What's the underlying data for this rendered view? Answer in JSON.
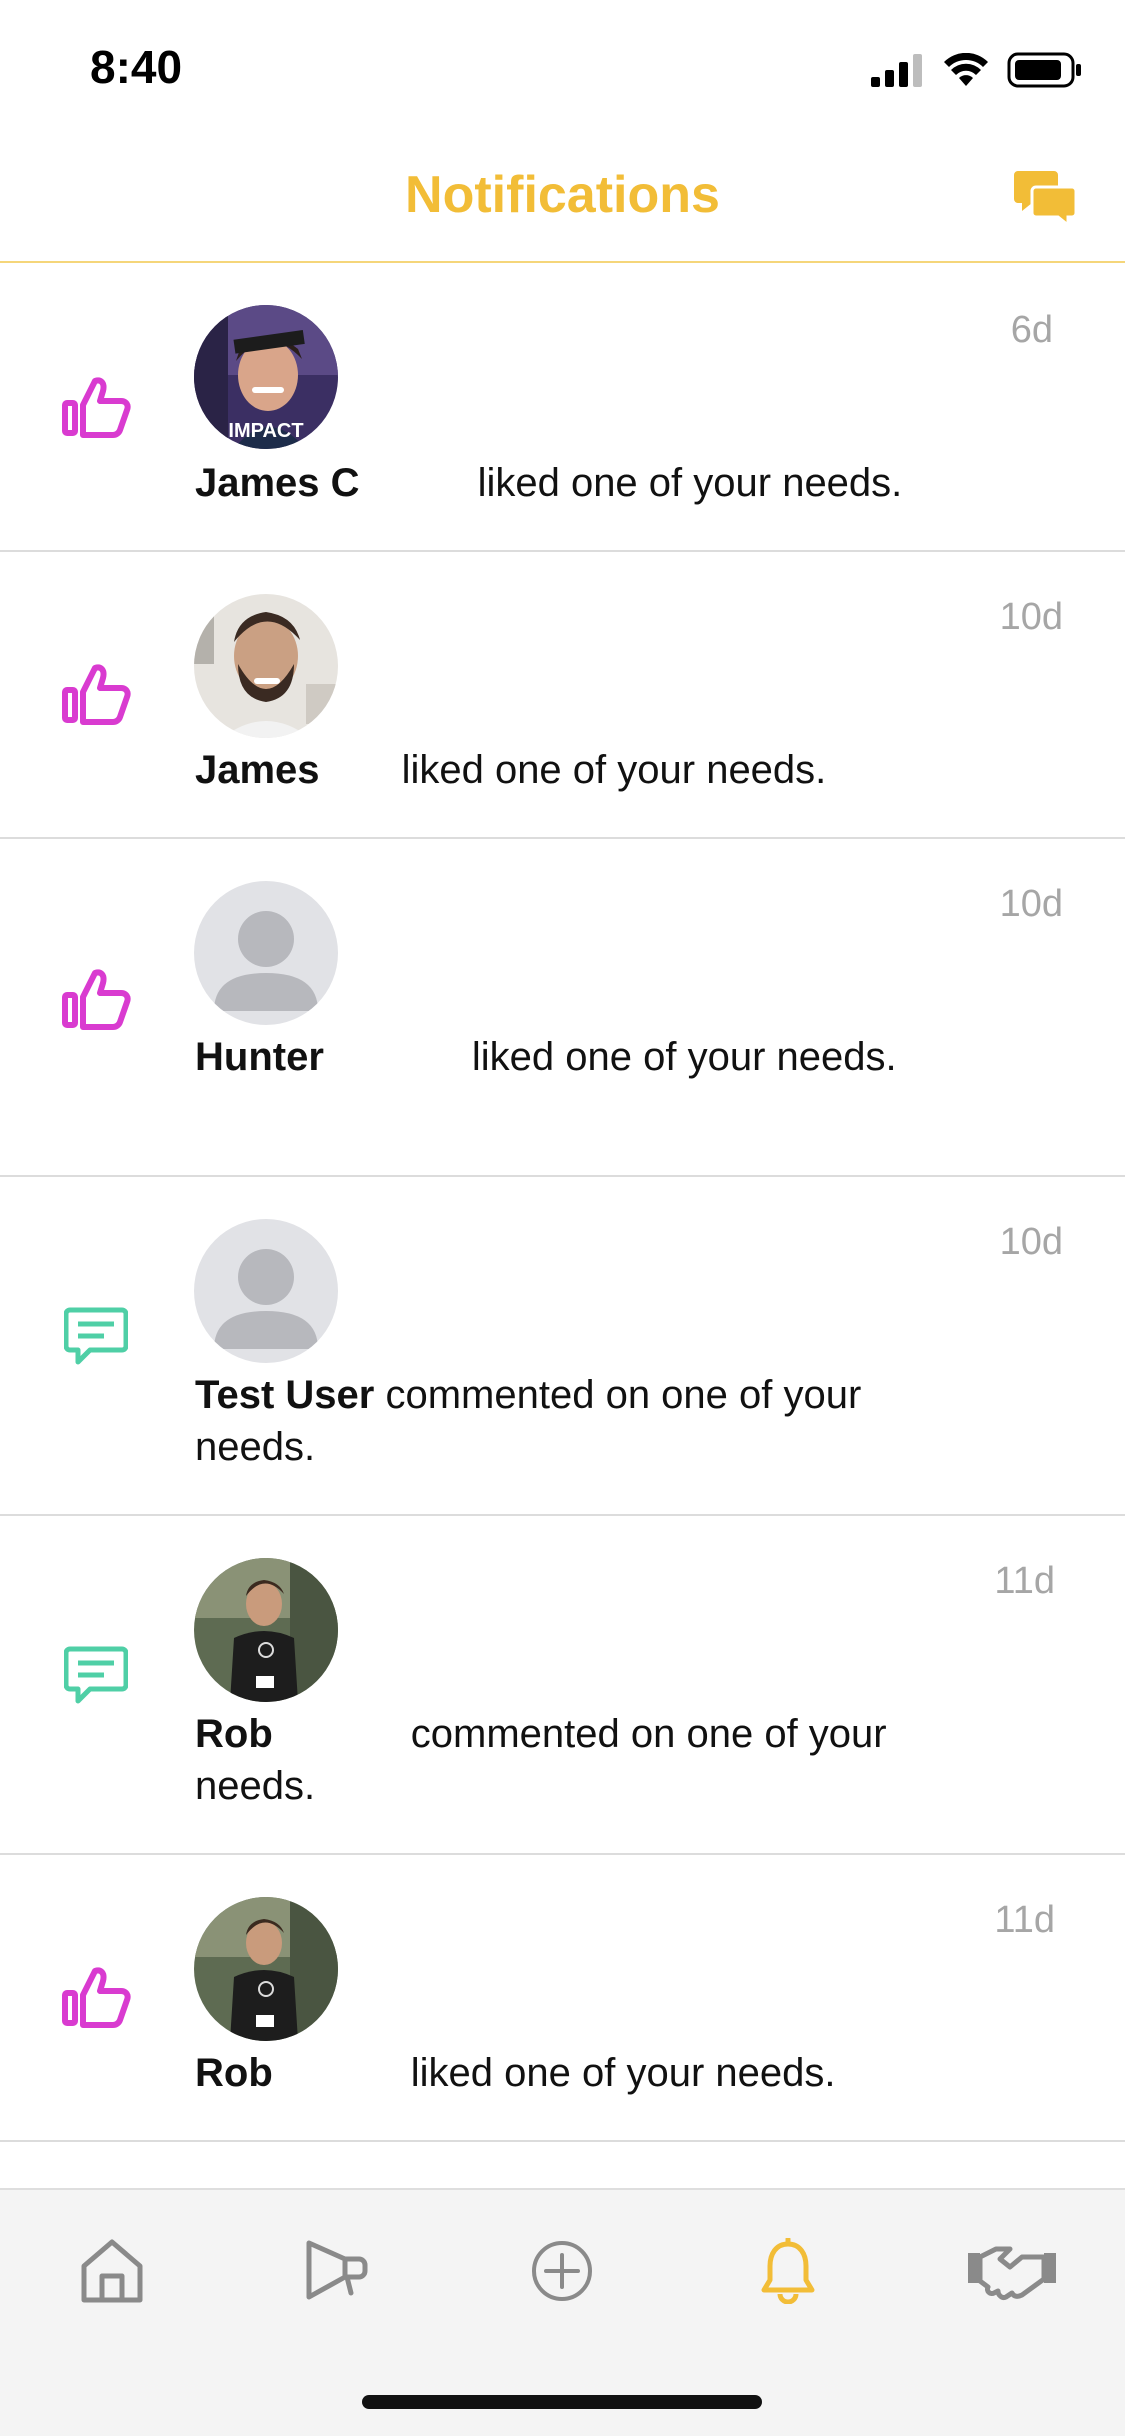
{
  "status_bar": {
    "time": "8:40"
  },
  "header": {
    "title": "Notifications",
    "title_color": "#f2bd37",
    "chat_icon": "chat-bubbles-icon"
  },
  "colors": {
    "like": "#d93bd0",
    "comment": "#4fcfa6",
    "accent": "#f2bd37",
    "timestamp": "#a6a6a6"
  },
  "notifications": [
    {
      "type": "like",
      "icon": "thumbs-up-icon",
      "name": "James C",
      "action": "liked one of your needs.",
      "time": "6d",
      "avatar": "photo",
      "avatar_badge": "IMPACT"
    },
    {
      "type": "like",
      "icon": "thumbs-up-icon",
      "name": "James",
      "action": "liked one of your needs.",
      "time": "10d",
      "avatar": "photo"
    },
    {
      "type": "like",
      "icon": "thumbs-up-icon",
      "name": "Hunter",
      "action": "liked one of your needs.",
      "time": "10d",
      "avatar": "placeholder"
    },
    {
      "type": "comment",
      "icon": "comment-icon",
      "name": "Test User",
      "action": "commented on one of your needs.",
      "time": "10d",
      "avatar": "placeholder"
    },
    {
      "type": "comment",
      "icon": "comment-icon",
      "name": "Rob",
      "action": "commented on one of your needs.",
      "time": "11d",
      "avatar": "photo"
    },
    {
      "type": "like",
      "icon": "thumbs-up-icon",
      "name": "Rob",
      "action": "liked one of your needs.",
      "time": "11d",
      "avatar": "photo"
    }
  ],
  "tabbar": {
    "tabs": [
      {
        "icon": "home-icon"
      },
      {
        "icon": "megaphone-icon"
      },
      {
        "icon": "add-circle-icon"
      },
      {
        "icon": "bell-icon",
        "active": true
      },
      {
        "icon": "handshake-icon"
      }
    ]
  }
}
